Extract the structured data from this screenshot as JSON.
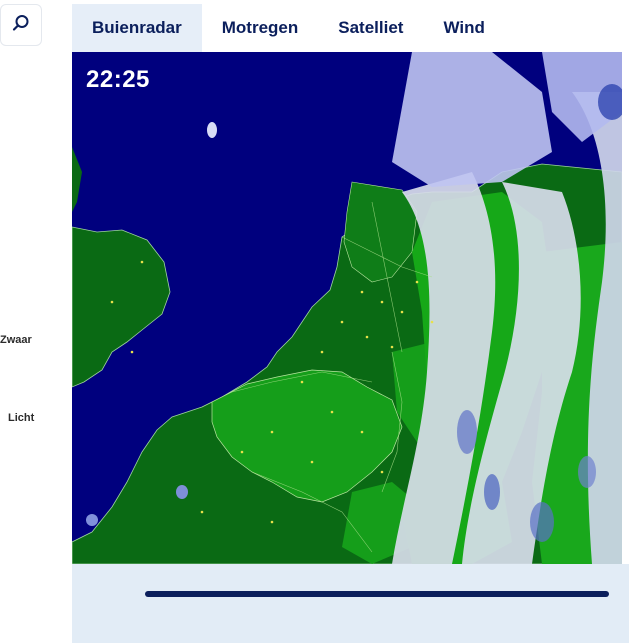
{
  "search": {
    "icon": "search-icon"
  },
  "legend": {
    "heavy_label": "Zwaar",
    "light_label": "Licht"
  },
  "tabs": [
    {
      "label": "Buienradar",
      "active": true
    },
    {
      "label": "Motregen",
      "active": false
    },
    {
      "label": "Satelliet",
      "active": false
    },
    {
      "label": "Wind",
      "active": false
    }
  ],
  "map": {
    "time": "22:25"
  },
  "colors": {
    "accent": "#0b1f5c",
    "sea": "#00007e",
    "tab_active_bg": "#e6eef8",
    "controls_bg": "#e2ecf6"
  }
}
